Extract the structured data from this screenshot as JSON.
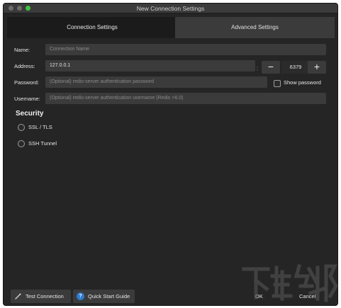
{
  "window": {
    "title": "New Connection Settings"
  },
  "tabs": [
    {
      "label": "Connection Settings",
      "active": true
    },
    {
      "label": "Advanced Settings",
      "active": false
    }
  ],
  "form": {
    "name": {
      "label": "Name:",
      "placeholder": "Connection Name",
      "value": ""
    },
    "address": {
      "label": "Address:",
      "value": "127.0.0.1",
      "separator": ":",
      "port": "6379",
      "decrement": "−",
      "increment": "+"
    },
    "password": {
      "label": "Password:",
      "placeholder": "(Optional) redis-server authentication password",
      "value": "",
      "show_password_label": "Show password",
      "show_password_checked": false
    },
    "username": {
      "label": "Username:",
      "placeholder": "(Optional) redis-server authentication username (Redis >6.0)",
      "value": ""
    }
  },
  "security": {
    "title": "Security",
    "options": [
      {
        "label": "SSL / TLS",
        "selected": false
      },
      {
        "label": "SSH Tunnel",
        "selected": false
      }
    ]
  },
  "footer": {
    "test_connection": "Test Connection",
    "quick_start": "Quick Start Guide",
    "help_glyph": "?",
    "ok": "OK",
    "cancel": "Cancel"
  },
  "colors": {
    "background": "#252525",
    "field": "#3b3b3b",
    "accent": "#2e7bcf",
    "traffic_green": "#3ec342"
  },
  "icons": [
    "close-dot-icon",
    "minimize-dot-icon",
    "maximize-dot-icon",
    "wand-icon",
    "help-icon"
  ]
}
